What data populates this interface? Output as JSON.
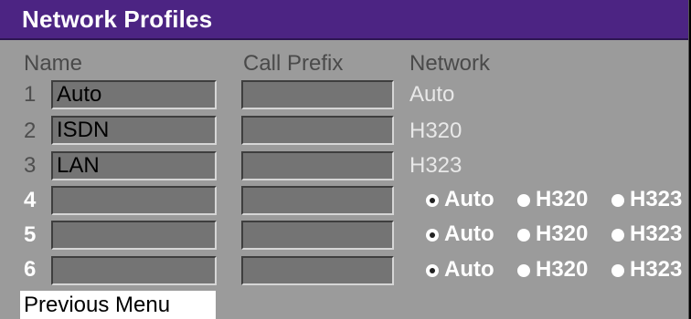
{
  "window": {
    "title": "Network Profiles"
  },
  "columns": {
    "name": "Name",
    "call_prefix": "Call Prefix",
    "network": "Network"
  },
  "rows": [
    {
      "num": "1",
      "name": "Auto",
      "prefix": "",
      "network": "Auto"
    },
    {
      "num": "2",
      "name": "ISDN",
      "prefix": "",
      "network": "H320"
    },
    {
      "num": "3",
      "name": "LAN",
      "prefix": "",
      "network": "H323"
    },
    {
      "num": "4",
      "name": "",
      "prefix": "",
      "options": [
        "Auto",
        "H320",
        "H323"
      ],
      "selected": "Auto"
    },
    {
      "num": "5",
      "name": "",
      "prefix": "",
      "options": [
        "Auto",
        "H320",
        "H323"
      ],
      "selected": "Auto"
    },
    {
      "num": "6",
      "name": "",
      "prefix": "",
      "options": [
        "Auto",
        "H320",
        "H323"
      ],
      "selected": "Auto"
    }
  ],
  "footer": {
    "previous_menu": "Previous Menu"
  },
  "colors": {
    "title_bar": "#4c2483",
    "background": "#9b9b9b",
    "field": "#747474",
    "highlight": "#ffffff"
  }
}
